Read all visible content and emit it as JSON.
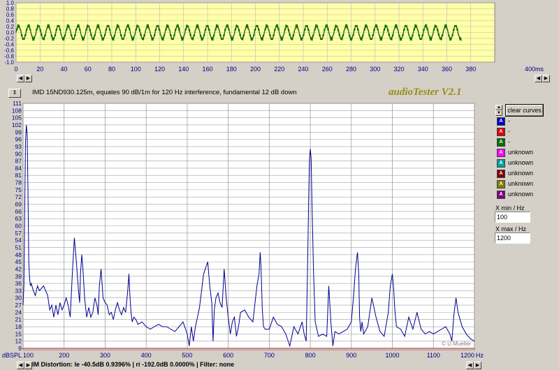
{
  "app": {
    "brand": "audioTester V2.1",
    "measurement_title": "IMD 15ND930.125m, equates 90 dB/1m for 120 Hz interference, fundamental 12 dB down"
  },
  "scope": {
    "y_ticks": [
      "1.0",
      "0.8",
      "0.6",
      "0.4",
      "0.2",
      "0.0",
      "-0.2",
      "-0.4",
      "-0.6",
      "-0.8",
      "-1.0"
    ],
    "x_ticks": [
      "0",
      "20",
      "40",
      "60",
      "80",
      "100",
      "120",
      "140",
      "160",
      "180",
      "200",
      "220",
      "240",
      "260",
      "280",
      "300",
      "320",
      "340",
      "360",
      "380"
    ],
    "x_unit": "400ms",
    "colors": {
      "background": "#ffffa8",
      "grid": "#b8b8b8",
      "signal": "#007000",
      "reference": "#e00000"
    }
  },
  "spectrum": {
    "y_unit": "dBSPL",
    "x_unit": "Hz",
    "watermark": "© U.Mueller",
    "colors": {
      "background": "#ffffff",
      "grid": "#a0a0a0",
      "trace": "#000090",
      "axis_text": "#000080"
    }
  },
  "chart_data": [
    {
      "type": "line",
      "title": "",
      "xlabel": "ms",
      "ylabel": "",
      "xlim": [
        0,
        400
      ],
      "ylim": [
        -1.0,
        1.0
      ],
      "grid": true,
      "series": [
        {
          "name": "",
          "x": [
            0,
            372
          ],
          "amplitude": 0.3,
          "fundamental_period_ms": 8.3
        }
      ]
    },
    {
      "type": "line",
      "title": "",
      "xlabel": "Hz",
      "ylabel": "dBSPL",
      "xlim": [
        100,
        1200
      ],
      "ylim": [
        9,
        111
      ],
      "y_ticks": [
        111,
        108,
        105,
        102,
        99,
        96,
        93,
        90,
        87,
        84,
        81,
        78,
        75,
        72,
        69,
        66,
        63,
        60,
        57,
        54,
        51,
        48,
        45,
        42,
        39,
        36,
        33,
        30,
        27,
        24,
        21,
        18,
        15,
        12,
        9
      ],
      "x_ticks": [
        100,
        200,
        300,
        400,
        500,
        600,
        700,
        800,
        900,
        1000,
        1100,
        1200
      ],
      "grid": true,
      "series": [
        {
          "name": "",
          "x": [
            100,
            102,
            104,
            106,
            108,
            110,
            112,
            114,
            116,
            118,
            120,
            125,
            130,
            135,
            140,
            145,
            150,
            155,
            160,
            165,
            170,
            175,
            180,
            185,
            190,
            195,
            200,
            205,
            210,
            215,
            220,
            225,
            230,
            235,
            238,
            240,
            243,
            246,
            250,
            255,
            260,
            265,
            270,
            275,
            280,
            283,
            286,
            290,
            295,
            300,
            305,
            310,
            315,
            320,
            325,
            330,
            335,
            340,
            345,
            350,
            355,
            358,
            360,
            363,
            366,
            370,
            375,
            380,
            390,
            400,
            410,
            420,
            430,
            440,
            450,
            460,
            470,
            480,
            490,
            500,
            505,
            510,
            515,
            520,
            525,
            530,
            540,
            550,
            555,
            560,
            563,
            566,
            570,
            575,
            580,
            585,
            590,
            595,
            600,
            605,
            610,
            615,
            620,
            625,
            630,
            640,
            650,
            660,
            670,
            675,
            678,
            680,
            683,
            686,
            690,
            700,
            710,
            720,
            730,
            740,
            750,
            760,
            770,
            780,
            785,
            790,
            793,
            796,
            798,
            800,
            802,
            804,
            808,
            812,
            820,
            830,
            840,
            845,
            850,
            855,
            860,
            870,
            880,
            890,
            900,
            905,
            910,
            915,
            918,
            920,
            923,
            926,
            930,
            940,
            950,
            960,
            970,
            980,
            990,
            995,
            1000,
            1003,
            1006,
            1010,
            1020,
            1030,
            1040,
            1050,
            1060,
            1070,
            1080,
            1090,
            1100,
            1110,
            1120,
            1130,
            1140,
            1145,
            1150,
            1155,
            1160,
            1170,
            1180,
            1190,
            1200
          ],
          "y": [
            27,
            35,
            65,
            95,
            102,
            98,
            75,
            45,
            38,
            35,
            36,
            33,
            31,
            35,
            33,
            34,
            35,
            33,
            31,
            25,
            27,
            22,
            27,
            23,
            28,
            25,
            27,
            30,
            27,
            22,
            40,
            55,
            45,
            33,
            28,
            40,
            48,
            42,
            30,
            22,
            26,
            22,
            24,
            30,
            27,
            23,
            35,
            42,
            30,
            28,
            27,
            23,
            24,
            21,
            25,
            28,
            25,
            23,
            26,
            24,
            33,
            40,
            32,
            24,
            20,
            22,
            21,
            19,
            20,
            18,
            17,
            18,
            19,
            18,
            18,
            17,
            16,
            18,
            20,
            15,
            10,
            18,
            12,
            18,
            22,
            26,
            40,
            45,
            35,
            28,
            12,
            25,
            30,
            32,
            28,
            26,
            42,
            30,
            22,
            15,
            20,
            22,
            14,
            18,
            24,
            25,
            22,
            20,
            35,
            40,
            49,
            42,
            25,
            18,
            17,
            17,
            22,
            19,
            18,
            15,
            10,
            18,
            15,
            20,
            15,
            12,
            40,
            70,
            88,
            92,
            88,
            70,
            40,
            20,
            14,
            15,
            14,
            35,
            20,
            10,
            16,
            15,
            16,
            17,
            20,
            30,
            42,
            49,
            40,
            22,
            16,
            20,
            15,
            18,
            30,
            22,
            16,
            14,
            24,
            35,
            40,
            34,
            25,
            18,
            17,
            14,
            22,
            17,
            24,
            17,
            15,
            16,
            15,
            16,
            17,
            18,
            15,
            12,
            23,
            30,
            24,
            18,
            15,
            13,
            12
          ]
        }
      ]
    }
  ],
  "legend": {
    "items": [
      {
        "letter": "A",
        "color": "#0000c0",
        "label": "-"
      },
      {
        "letter": "A",
        "color": "#e00000",
        "label": "-"
      },
      {
        "letter": "A",
        "color": "#007000",
        "label": "-"
      },
      {
        "letter": "A",
        "color": "#ff00ff",
        "label": "unknown"
      },
      {
        "letter": "A",
        "color": "#00a0a0",
        "label": "unknown"
      },
      {
        "letter": "A",
        "color": "#800000",
        "label": "unknown"
      },
      {
        "letter": "A",
        "color": "#808000",
        "label": "unknown"
      },
      {
        "letter": "A",
        "color": "#800080",
        "label": "unknown"
      }
    ]
  },
  "controls": {
    "clear_curves": "clear curves",
    "xmin_label": "X min / Hz",
    "xmin_value": "100",
    "xmax_label": "X max / Hz",
    "xmax_value": "1200"
  },
  "status": {
    "text": "IM Distortion: le -40.5dB  0.9396% | ri -192.0dB  0.0000% |   Filter: none"
  },
  "icons": {
    "nav_left": "arrow-left-icon",
    "nav_right": "arrow-right-icon",
    "spin": "up-down-icon"
  }
}
